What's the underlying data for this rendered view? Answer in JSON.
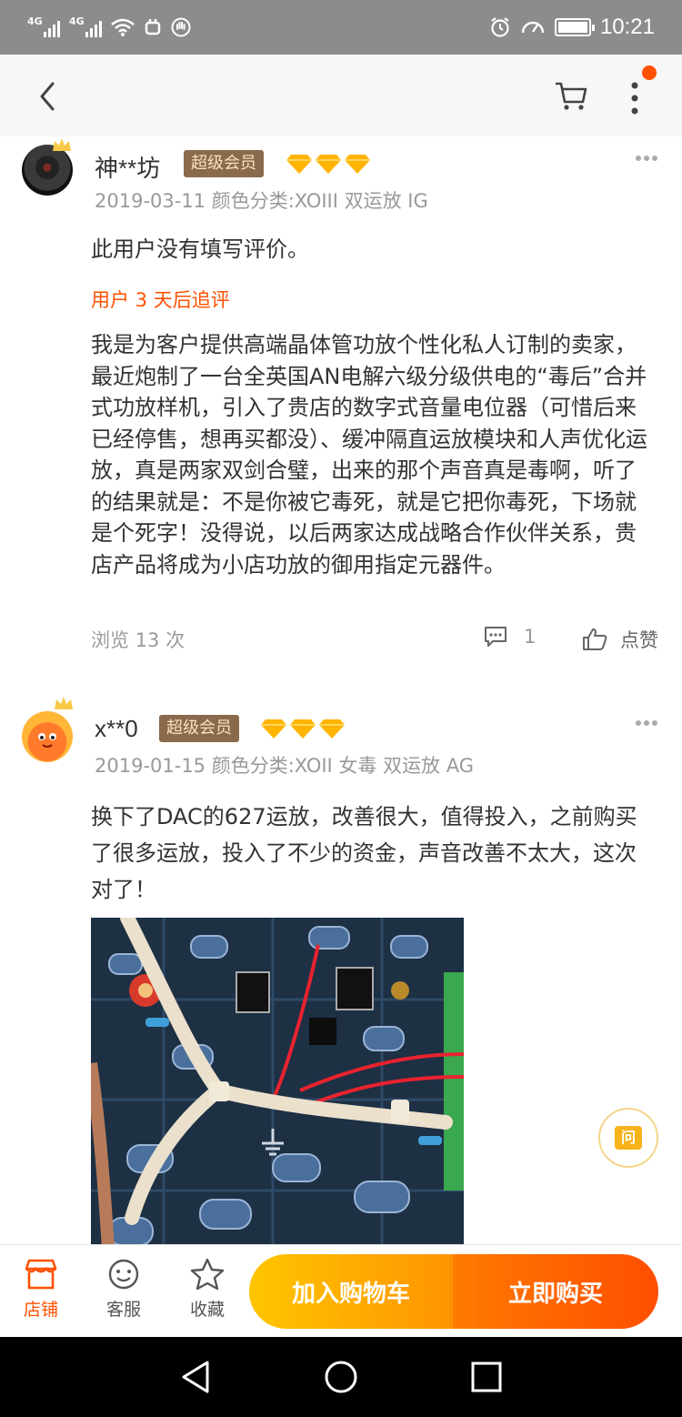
{
  "status_bar": {
    "signal1_tag": "4G",
    "signal2_tag": "4G",
    "time": "10:21"
  },
  "nav": {
    "back_icon": "back-arrow-icon",
    "cart_icon": "cart-icon",
    "more_icon": "more-vertical-icon",
    "accent_color": "#ff5000"
  },
  "reviews": [
    {
      "username": "神**坊",
      "vip_label": "超级会员",
      "meta": "2019-03-11 颜色分类:XOIII 双运放 IG",
      "text": "此用户没有填写评价。",
      "append_label": "用户 3 天后追评",
      "append_text": "我是为客户提供高端晶体管功放个性化私人订制的卖家，最近炮制了一台全英国AN电解六级分级供电的“毒后”合并式功放样机，引入了贵店的数字式音量电位器（可惜后来已经停售，想再买都没）、缓冲隔直运放模块和人声优化运放，真是两家双剑合璧，出来的那个声音真是毒啊，听了的结果就是：不是你被它毒死，就是它把你毒死，下场就是个死字！没得说，以后两家达成战略合作伙伴关系，贵店产品将成为小店功放的御用指定元器件。",
      "views": "浏览 13 次",
      "comment_count": "1",
      "like_label": "点赞"
    },
    {
      "username": "x**0",
      "vip_label": "超级会员",
      "meta": "2019-01-15 颜色分类:XOII 女毒 双运放 AG",
      "text": "换下了DAC的627运放，改善很大，值得投入，之前购买了很多运放，投入了不少的资金，声音改善不太大，这次对了！"
    }
  ],
  "ask_button": {
    "label": "问"
  },
  "bottom_bar": {
    "shop_label": "店铺",
    "service_label": "客服",
    "favorite_label": "收藏",
    "add_to_cart": "加入购物车",
    "buy_now": "立即购买"
  },
  "system_nav": {
    "back_icon": "triangle-back-icon",
    "home_icon": "circle-home-icon",
    "recent_icon": "square-recent-icon"
  }
}
